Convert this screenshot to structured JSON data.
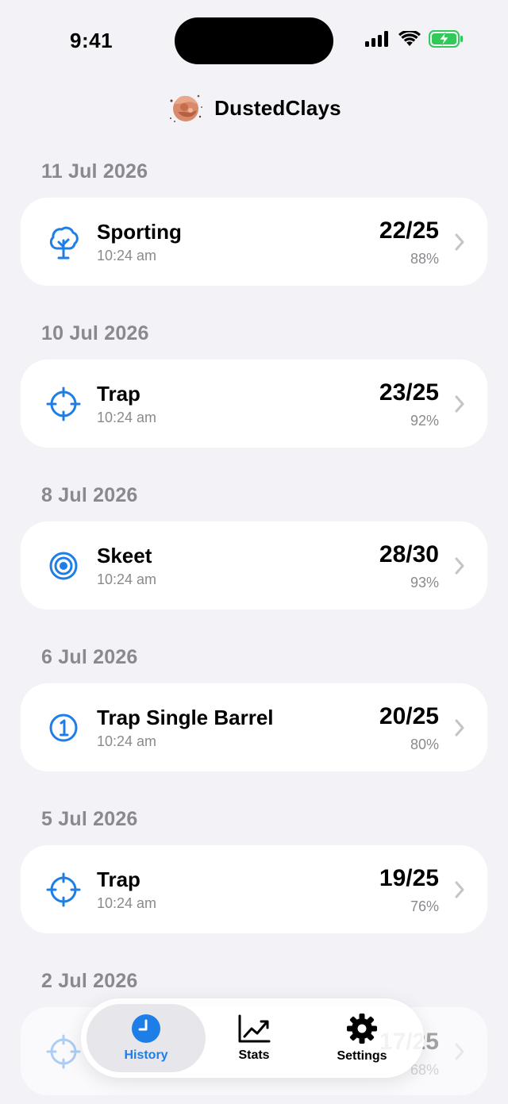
{
  "status_bar": {
    "time": "9:41"
  },
  "header": {
    "app_title": "DustedClays",
    "logo_icon": "clay-target-logo"
  },
  "sections": [
    {
      "date": "11 Jul 2026",
      "session": {
        "type": "Sporting",
        "time": "10:24 am",
        "score": "22/25",
        "percent": "88%",
        "icon": "tree-icon"
      }
    },
    {
      "date": "10 Jul 2026",
      "session": {
        "type": "Trap",
        "time": "10:24 am",
        "score": "23/25",
        "percent": "92%",
        "icon": "crosshair-icon"
      }
    },
    {
      "date": "8 Jul 2026",
      "session": {
        "type": "Skeet",
        "time": "10:24 am",
        "score": "28/30",
        "percent": "93%",
        "icon": "target-icon"
      }
    },
    {
      "date": "6 Jul 2026",
      "session": {
        "type": "Trap Single Barrel",
        "time": "10:24 am",
        "score": "20/25",
        "percent": "80%",
        "icon": "number-one-circle-icon"
      }
    },
    {
      "date": "5 Jul 2026",
      "session": {
        "type": "Trap",
        "time": "10:24 am",
        "score": "19/25",
        "percent": "76%",
        "icon": "crosshair-icon"
      }
    },
    {
      "date": "2 Jul 2026",
      "session": {
        "type": "",
        "time": "",
        "score": "17/25",
        "percent": "68%",
        "icon": "crosshair-icon"
      }
    }
  ],
  "tab_bar": {
    "tabs": [
      {
        "label": "History",
        "icon": "clock-icon",
        "selected": true
      },
      {
        "label": "Stats",
        "icon": "chart-line-icon",
        "selected": false
      },
      {
        "label": "Settings",
        "icon": "gear-icon",
        "selected": false
      }
    ]
  },
  "colors": {
    "accent": "#1E7EE8",
    "background": "#F2F2F7",
    "card": "#FFFFFF",
    "secondary_text": "#8A8A8E",
    "battery": "#34C759"
  }
}
